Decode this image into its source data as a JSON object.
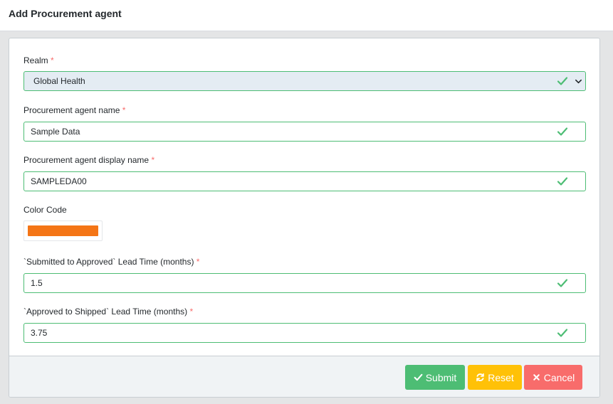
{
  "header": {
    "title": "Add Procurement agent"
  },
  "form": {
    "required_marker": "*",
    "realm": {
      "label": "Realm",
      "value": "Global Health"
    },
    "agent_name": {
      "label": "Procurement agent name",
      "value": "Sample Data"
    },
    "display_name": {
      "label": "Procurement agent display name",
      "value": "SAMPLEDA00"
    },
    "color_code": {
      "label": "Color Code",
      "color": "#f47516"
    },
    "submitted_to_approved": {
      "label": "`Submitted to Approved` Lead Time (months)",
      "value": "1.5"
    },
    "approved_to_shipped": {
      "label": "`Approved to Shipped` Lead Time (months)",
      "value": "3.75"
    }
  },
  "footer": {
    "submit_label": "Submit",
    "reset_label": "Reset",
    "cancel_label": "Cancel"
  },
  "colors": {
    "valid": "#4dbd74",
    "submit": "#4dbd74",
    "reset": "#ffc107",
    "cancel": "#f86c6b"
  },
  "icons": {
    "valid": "check-icon",
    "select": "chevron-down-icon",
    "submit": "check-icon",
    "reset": "refresh-icon",
    "cancel": "times-icon"
  }
}
